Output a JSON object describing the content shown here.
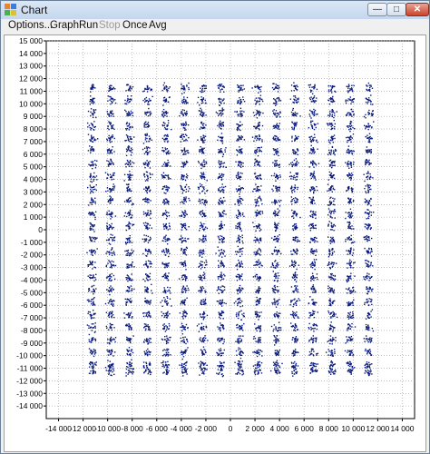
{
  "window": {
    "title": "Chart",
    "min_glyph": "—",
    "max_glyph": "□",
    "close_glyph": "✕"
  },
  "menu": {
    "items": [
      {
        "label": "Options...",
        "enabled": true
      },
      {
        "label": "Graph",
        "enabled": true
      },
      {
        "label": "Run",
        "enabled": true
      },
      {
        "label": "Stop",
        "enabled": false
      },
      {
        "label": "Once",
        "enabled": true
      },
      {
        "label": "Avg",
        "enabled": true
      }
    ]
  },
  "chart_data": {
    "type": "scatter",
    "title": "",
    "xlabel": "",
    "ylabel": "",
    "xlim": [
      -15000,
      15000
    ],
    "ylim": [
      -15000,
      15000
    ],
    "x_ticks": [
      -14000,
      -12000,
      -10000,
      -8000,
      -6000,
      -4000,
      -2000,
      0,
      2000,
      4000,
      6000,
      8000,
      10000,
      12000,
      14000
    ],
    "x_tick_labels": [
      "-14 000",
      "-12 000",
      "-10 000",
      "-8 000",
      "-6 000",
      "-4 000",
      "-2 000",
      "0",
      "2 000",
      "4 000",
      "6 000",
      "8 000",
      "10 000",
      "12 000",
      "14 000"
    ],
    "y_ticks": [
      15000,
      14000,
      13000,
      12000,
      11000,
      10000,
      9000,
      8000,
      7000,
      6000,
      5000,
      4000,
      3000,
      2000,
      1000,
      0,
      -1000,
      -2000,
      -3000,
      -4000,
      -5000,
      -6000,
      -7000,
      -8000,
      -9000,
      -10000,
      -11000,
      -12000,
      -13000,
      -14000
    ],
    "y_tick_labels": [
      "15 000",
      "14 000",
      "13 000",
      "12 000",
      "11 000",
      "10 000",
      "9 000",
      "8 000",
      "7 000",
      "6 000",
      "5 000",
      "4 000",
      "3 000",
      "2 000",
      "1 000",
      "0",
      "-1 000",
      "-2 000",
      "-3 000",
      "-4 000",
      "-5 000",
      "-6 000",
      "-7 000",
      "-8 000",
      "-9 000",
      "-10 000",
      "-11 000",
      "-12 000",
      "-13 000",
      "-14 000"
    ],
    "grid": true,
    "point_color": "#0a1a7a",
    "cluster_centers_x": [
      -11250,
      -9750,
      -8250,
      -6750,
      -5250,
      -3750,
      -2250,
      -750,
      750,
      2250,
      3750,
      5250,
      6750,
      8250,
      9750,
      11250
    ],
    "cluster_centers_y": [
      11250,
      10250,
      9250,
      8250,
      7250,
      6250,
      5250,
      4250,
      3250,
      2250,
      1250,
      250,
      -750,
      -1750,
      -2750,
      -3750,
      -4750,
      -5750,
      -6750,
      -7750,
      -8750,
      -9750,
      -10750,
      -11250
    ],
    "cluster_spread": 350,
    "points_per_cluster": 18
  }
}
